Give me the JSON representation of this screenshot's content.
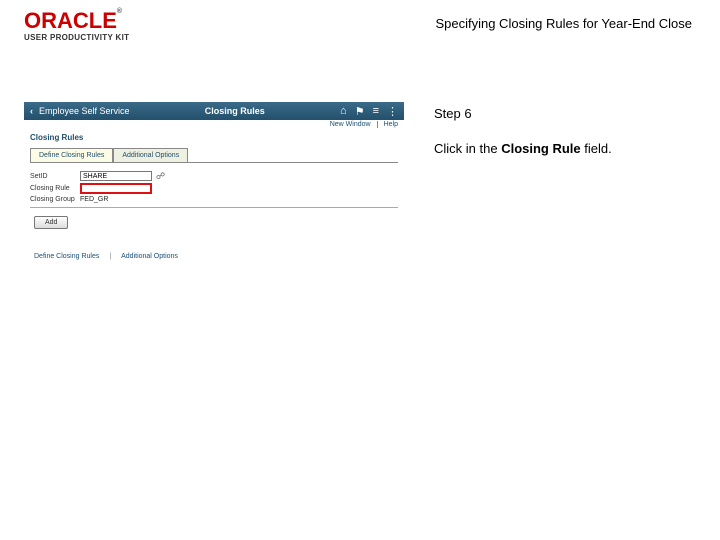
{
  "header": {
    "logo_main": "ORACLE",
    "logo_sub": "USER PRODUCTIVITY KIT",
    "page_title": "Specifying Closing Rules for Year-End Close"
  },
  "screenshot": {
    "bar": {
      "back_symbol": "‹",
      "back_label": "Employee Self Service",
      "title": "Closing Rules",
      "icons": {
        "home": "⌂",
        "flag": "⚑",
        "menu_lines": "≡",
        "menu_dots": "⋮"
      }
    },
    "subbar": {
      "new_window": "New Window",
      "help": "Help"
    },
    "section_title": "Closing Rules",
    "tabs": {
      "active": "Define Closing Rules",
      "inactive": "Additional Options"
    },
    "form": {
      "setid_label": "SetID",
      "setid_value": "SHARE",
      "lookup_glyph": "☍",
      "closing_rule_label": "Closing Rule",
      "closing_rule_value": "",
      "closing_group_label": "Closing Group",
      "closing_group_value": "FED_GR"
    },
    "add_button": "Add",
    "footer": {
      "link1": "Define Closing Rules",
      "sep": "|",
      "link2": "Additional Options"
    }
  },
  "instructions": {
    "step": "Step 6",
    "text_pre": "Click in the ",
    "text_bold": "Closing Rule",
    "text_post": " field."
  }
}
